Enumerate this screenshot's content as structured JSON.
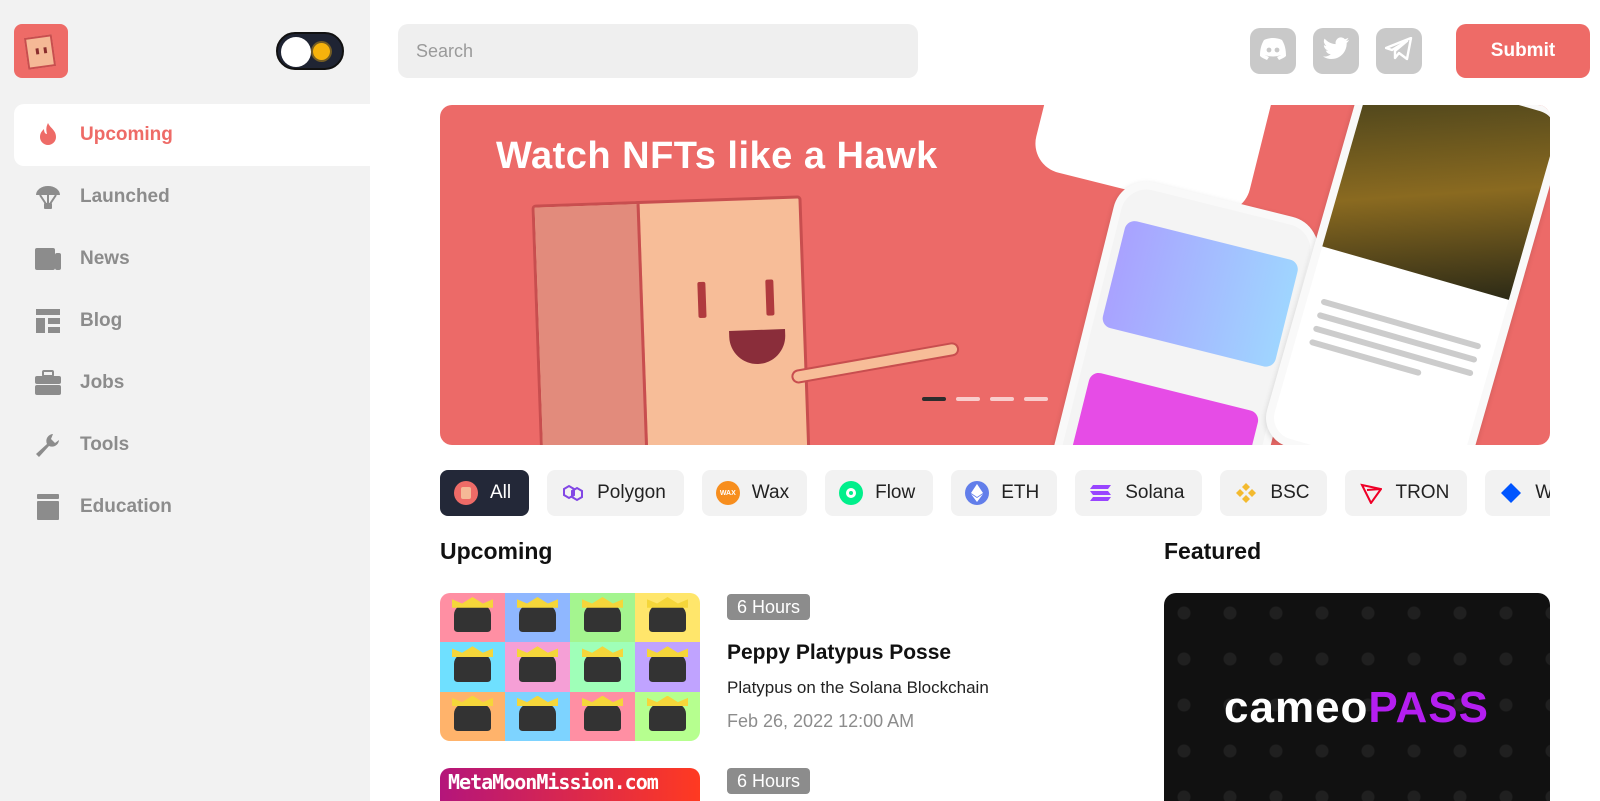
{
  "theme": {
    "accent": "#ee6b67",
    "sidebar_bg": "#f2f2f2",
    "dark": "#232838"
  },
  "sidebar": {
    "logo": "hawk-box-logo",
    "theme_toggle": "dark-mode",
    "items": [
      {
        "label": "Upcoming",
        "icon": "flame-icon",
        "active": true
      },
      {
        "label": "Launched",
        "icon": "parachute-icon",
        "active": false
      },
      {
        "label": "News",
        "icon": "newspaper-icon",
        "active": false
      },
      {
        "label": "Blog",
        "icon": "layout-icon",
        "active": false
      },
      {
        "label": "Jobs",
        "icon": "briefcase-icon",
        "active": false
      },
      {
        "label": "Tools",
        "icon": "wrench-icon",
        "active": false
      },
      {
        "label": "Education",
        "icon": "book-icon",
        "active": false
      }
    ]
  },
  "header": {
    "search_placeholder": "Search",
    "socials": [
      "discord-icon",
      "twitter-icon",
      "telegram-icon"
    ],
    "submit_label": "Submit"
  },
  "hero": {
    "title": "Watch NFTs like a Hawk",
    "slide_count": 4,
    "active_slide": 1
  },
  "chains": [
    {
      "label": "All",
      "active": true,
      "color": "#ee6b67"
    },
    {
      "label": "Polygon",
      "active": false,
      "color": "#8247e5"
    },
    {
      "label": "Wax",
      "active": false,
      "color": "#f78e1e"
    },
    {
      "label": "Flow",
      "active": false,
      "color": "#00ef8b"
    },
    {
      "label": "ETH",
      "active": false,
      "color": "#627eea"
    },
    {
      "label": "Solana",
      "active": false,
      "color": "#9945ff"
    },
    {
      "label": "BSC",
      "active": false,
      "color": "#f3ba2f"
    },
    {
      "label": "TRON",
      "active": false,
      "color": "#ef0027"
    },
    {
      "label": "Wav",
      "active": false,
      "color": "#0055ff"
    }
  ],
  "upcoming": {
    "heading": "Upcoming",
    "items": [
      {
        "badge": "6 Hours",
        "title": "Peppy Platypus Posse",
        "description": "Platypus on the Solana Blockchain",
        "date": "Feb 26, 2022 12:00 AM"
      },
      {
        "badge": "6 Hours",
        "image_text": "MetaMoonMission.com"
      }
    ]
  },
  "featured": {
    "heading": "Featured",
    "brand_a": "cameo",
    "brand_b": "PASS"
  }
}
